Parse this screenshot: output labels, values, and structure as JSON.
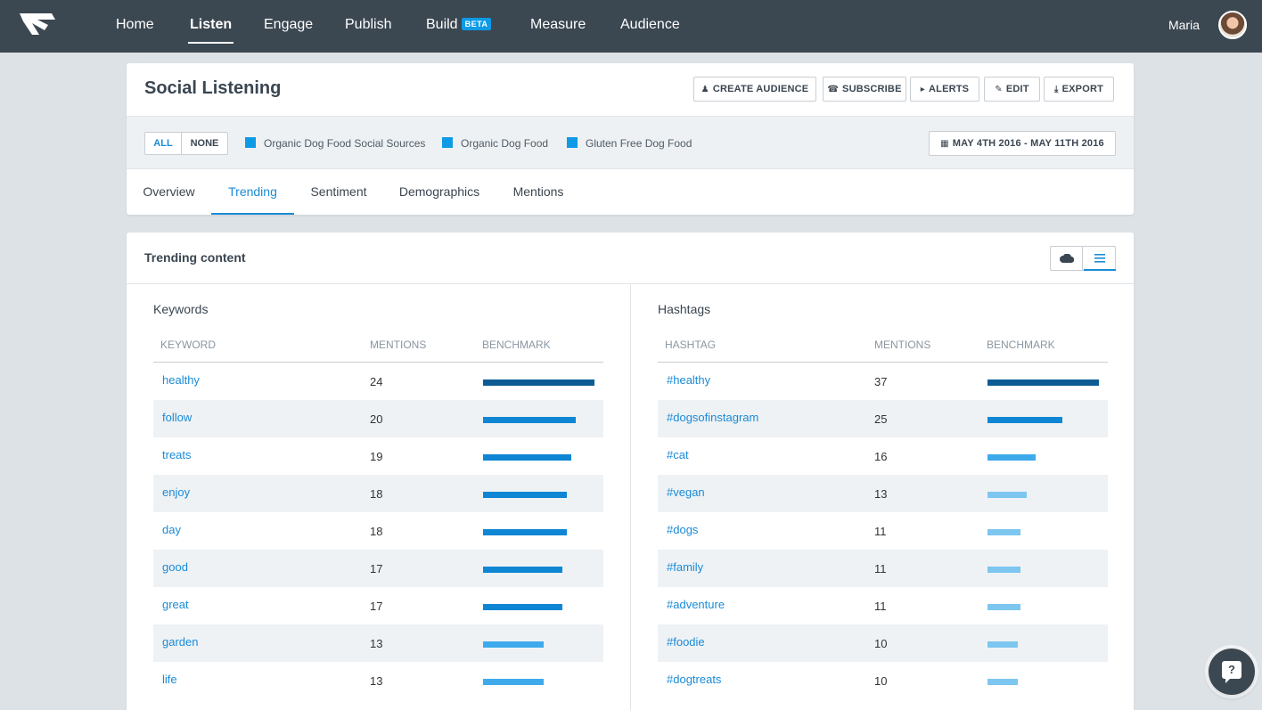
{
  "nav": {
    "items": [
      {
        "label": "Home",
        "active": false
      },
      {
        "label": "Listen",
        "active": true
      },
      {
        "label": "Engage",
        "active": false
      },
      {
        "label": "Publish",
        "active": false
      },
      {
        "label": "Build",
        "active": false,
        "badge": "BETA"
      },
      {
        "label": "Measure",
        "active": false
      },
      {
        "label": "Audience",
        "active": false
      }
    ],
    "user_name": "Maria"
  },
  "header": {
    "title": "Social Listening",
    "actions": {
      "create_audience": "CREATE AUDIENCE",
      "subscribe": "SUBSCRIBE",
      "alerts": "ALERTS",
      "edit": "EDIT",
      "export": "EXPORT"
    },
    "filter": {
      "all": "ALL",
      "none": "NONE",
      "sources": [
        "Organic Dog Food Social Sources",
        "Organic Dog Food",
        "Gluten Free Dog Food"
      ],
      "source_color": "#0f9ae6",
      "date_range": "MAY 4TH 2016 - MAY 11TH 2016"
    },
    "tabs": [
      {
        "label": "Overview",
        "active": false
      },
      {
        "label": "Trending",
        "active": true
      },
      {
        "label": "Sentiment",
        "active": false
      },
      {
        "label": "Demographics",
        "active": false
      },
      {
        "label": "Mentions",
        "active": false
      }
    ]
  },
  "trending": {
    "title": "Trending content",
    "view_toggle": {
      "cloud_icon": "cloud-icon",
      "list_icon": "list-icon",
      "selected": "list"
    },
    "keywords": {
      "title": "Keywords",
      "columns": {
        "term": "KEYWORD",
        "mentions": "MENTIONS",
        "benchmark": "BENCHMARK"
      },
      "rows": [
        {
          "term": "healthy",
          "mentions": 24
        },
        {
          "term": "follow",
          "mentions": 20
        },
        {
          "term": "treats",
          "mentions": 19
        },
        {
          "term": "enjoy",
          "mentions": 18
        },
        {
          "term": "day",
          "mentions": 18
        },
        {
          "term": "good",
          "mentions": 17
        },
        {
          "term": "great",
          "mentions": 17
        },
        {
          "term": "garden",
          "mentions": 13
        },
        {
          "term": "life",
          "mentions": 13
        }
      ]
    },
    "hashtags": {
      "title": "Hashtags",
      "columns": {
        "term": "HASHTAG",
        "mentions": "MENTIONS",
        "benchmark": "BENCHMARK"
      },
      "rows": [
        {
          "term": "#healthy",
          "mentions": 37
        },
        {
          "term": "#dogsofinstagram",
          "mentions": 25
        },
        {
          "term": "#cat",
          "mentions": 16
        },
        {
          "term": "#vegan",
          "mentions": 13
        },
        {
          "term": "#dogs",
          "mentions": 11
        },
        {
          "term": "#family",
          "mentions": 11
        },
        {
          "term": "#adventure",
          "mentions": 11
        },
        {
          "term": "#foodie",
          "mentions": 10
        },
        {
          "term": "#dogtreats",
          "mentions": 10
        }
      ]
    },
    "bar_colors": {
      "dark": "#0d5c94",
      "mid": "#0f86d4",
      "light": "#3eaaeb",
      "pale": "#7cc6f0"
    }
  }
}
